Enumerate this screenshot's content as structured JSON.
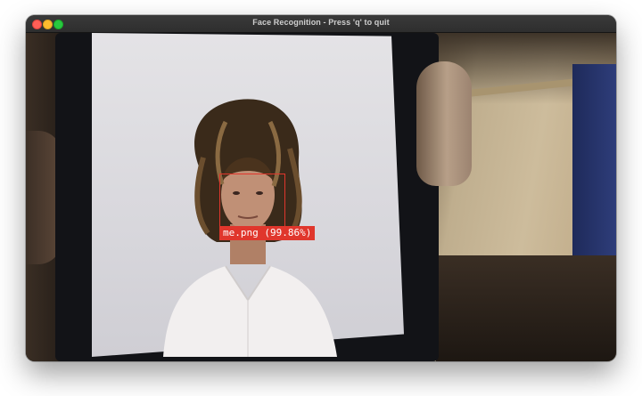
{
  "window": {
    "title": "Face Recognition - Press 'q' to quit"
  },
  "detection": {
    "label": "me.png (99.86%)",
    "box_color": "#e0362c",
    "confidence": 99.86
  },
  "colors": {
    "titlebar": "#333333",
    "close": "#ff5f57",
    "minimize": "#febc2e",
    "maximize": "#28c840"
  }
}
